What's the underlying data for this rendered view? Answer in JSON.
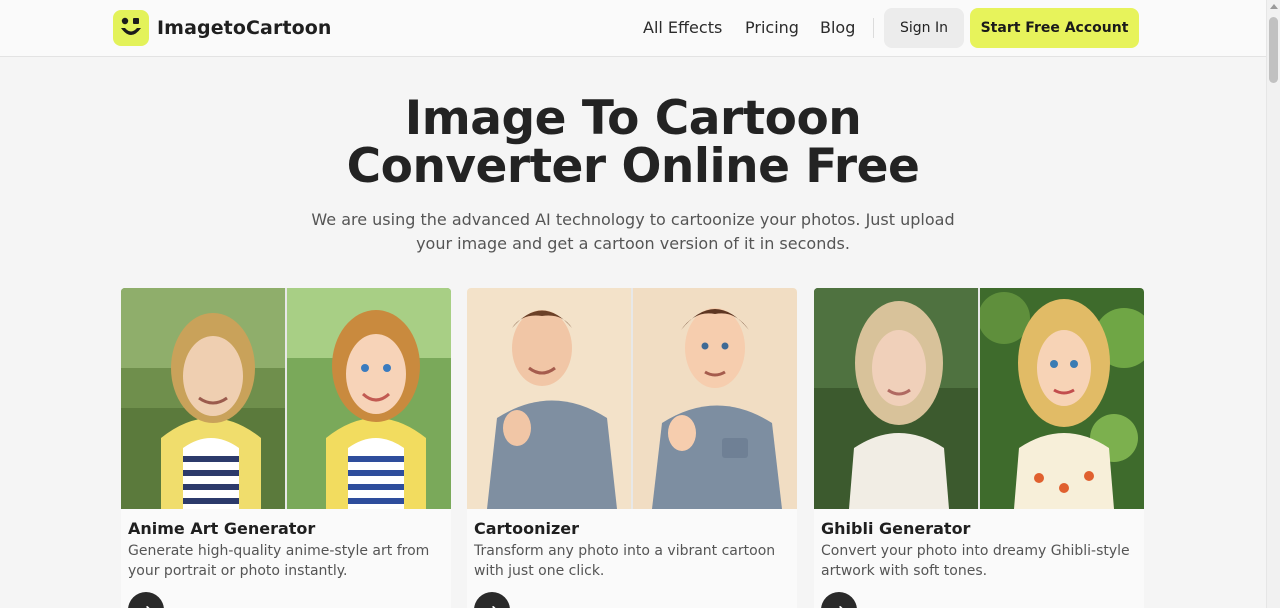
{
  "header": {
    "brand": "ImagetoCartoon",
    "nav": [
      "All Effects",
      "Pricing",
      "Blog"
    ],
    "signin_label": "Sign In",
    "cta_label": "Start Free Account",
    "logo_color": "#e3f25a",
    "cta_color": "#e7f35b"
  },
  "hero": {
    "title_line1": "Image To Cartoon",
    "title_line2": "Converter Online Free",
    "subtitle_line1": "We are using the advanced AI technology to cartoonize your photos. Just upload",
    "subtitle_line2": "your image and get a cartoon version of it in seconds."
  },
  "cards": [
    {
      "title": "Anime Art Generator",
      "desc_line1": "Generate high-quality anime-style art from",
      "desc_line2": "your portrait or photo instantly."
    },
    {
      "title": "Cartoonizer",
      "desc_line1": "Transform any photo into a vibrant cartoon",
      "desc_line2": "with just one click."
    },
    {
      "title": "Ghibli Generator",
      "desc_line1": "Convert your photo into dreamy Ghibli-style",
      "desc_line2": "artwork with soft tones."
    }
  ]
}
